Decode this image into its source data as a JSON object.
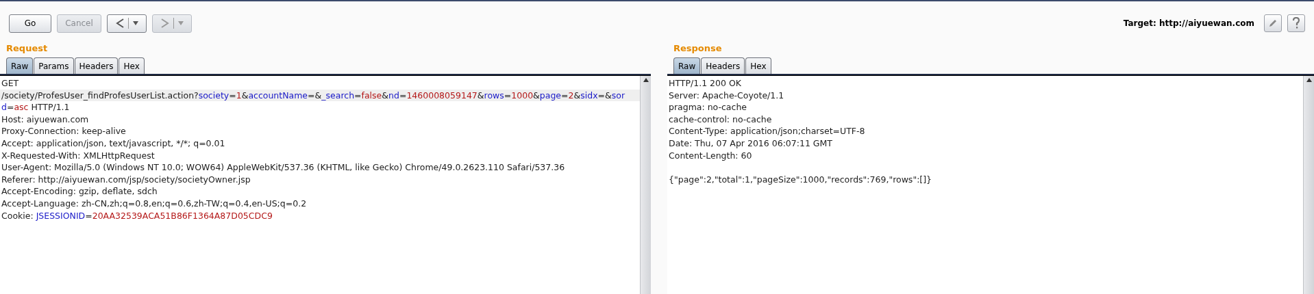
{
  "toolbar": {
    "buttons": [
      {
        "kind": "text",
        "label": "Go",
        "disabled": false
      },
      {
        "kind": "text",
        "label": "Cancel",
        "disabled": true
      },
      {
        "kind": "back",
        "disabled": false
      },
      {
        "kind": "forward",
        "disabled": true
      }
    ],
    "target": "Target: http://aiyuewan.com"
  },
  "request": {
    "title": "Request",
    "tabs": [
      {
        "label": "Raw",
        "selected": true
      },
      {
        "label": "Params",
        "selected": false
      },
      {
        "label": "Headers",
        "selected": false
      },
      {
        "label": "Hex",
        "selected": false
      }
    ],
    "lines": [
      {
        "current": false,
        "segments": [
          {
            "kind": "plain",
            "text": "GET"
          }
        ]
      },
      {
        "current": true,
        "segments": [
          {
            "kind": "plain",
            "text": "/society/ProfesUser_findProfesUserList.action?"
          },
          {
            "kind": "name",
            "text": "society"
          },
          {
            "kind": "plain",
            "text": "="
          },
          {
            "kind": "value",
            "text": "1"
          },
          {
            "kind": "plain",
            "text": "&"
          },
          {
            "kind": "name",
            "text": "accountName"
          },
          {
            "kind": "plain",
            "text": "=&"
          },
          {
            "kind": "name",
            "text": "_search"
          },
          {
            "kind": "plain",
            "text": "="
          },
          {
            "kind": "value",
            "text": "false"
          },
          {
            "kind": "plain",
            "text": "&"
          },
          {
            "kind": "name",
            "text": "nd"
          },
          {
            "kind": "plain",
            "text": "="
          },
          {
            "kind": "value",
            "text": "1460008059147"
          },
          {
            "kind": "plain",
            "text": "&"
          },
          {
            "kind": "name",
            "text": "rows"
          },
          {
            "kind": "plain",
            "text": "="
          },
          {
            "kind": "value",
            "text": "1000"
          },
          {
            "kind": "plain",
            "text": "&"
          },
          {
            "kind": "name",
            "text": "page"
          },
          {
            "kind": "plain",
            "text": "="
          },
          {
            "kind": "value",
            "text": "2"
          },
          {
            "kind": "plain",
            "text": "&"
          },
          {
            "kind": "name",
            "text": "sidx"
          },
          {
            "kind": "plain",
            "text": "=&"
          },
          {
            "kind": "name",
            "text": "sor"
          }
        ]
      },
      {
        "current": false,
        "segments": [
          {
            "kind": "name",
            "text": "d"
          },
          {
            "kind": "plain",
            "text": "="
          },
          {
            "kind": "value",
            "text": "asc"
          },
          {
            "kind": "plain",
            "text": " HTTP/1.1"
          }
        ]
      },
      {
        "current": false,
        "segments": [
          {
            "kind": "plain",
            "text": "Host: aiyuewan.com"
          }
        ]
      },
      {
        "current": false,
        "segments": [
          {
            "kind": "plain",
            "text": "Proxy-Connection: keep-alive"
          }
        ]
      },
      {
        "current": false,
        "segments": [
          {
            "kind": "plain",
            "text": "Accept: application/json, text/javascript, */*; q=0.01"
          }
        ]
      },
      {
        "current": false,
        "segments": [
          {
            "kind": "plain",
            "text": "X-Requested-With: XMLHttpRequest"
          }
        ]
      },
      {
        "current": false,
        "segments": [
          {
            "kind": "plain",
            "text": "User-Agent: Mozilla/5.0 (Windows NT 10.0; WOW64) AppleWebKit/537.36 (KHTML, like Gecko) Chrome/49.0.2623.110 Safari/537.36"
          }
        ]
      },
      {
        "current": false,
        "segments": [
          {
            "kind": "plain",
            "text": "Referer: http://aiyuewan.com/jsp/society/societyOwner.jsp"
          }
        ]
      },
      {
        "current": false,
        "segments": [
          {
            "kind": "plain",
            "text": "Accept-Encoding: gzip, deflate, sdch"
          }
        ]
      },
      {
        "current": false,
        "segments": [
          {
            "kind": "plain",
            "text": "Accept-Language: zh-CN,zh;q=0.8,en;q=0.6,zh-TW;q=0.4,en-US;q=0.2"
          }
        ]
      },
      {
        "current": false,
        "segments": [
          {
            "kind": "plain",
            "text": "Cookie: "
          },
          {
            "kind": "name",
            "text": "JSESSIONID"
          },
          {
            "kind": "plain",
            "text": "="
          },
          {
            "kind": "value",
            "text": "20AA32539ACA51B86F1364A87D05CDC9"
          }
        ]
      }
    ]
  },
  "response": {
    "title": "Response",
    "tabs": [
      {
        "label": "Raw",
        "selected": true
      },
      {
        "label": "Headers",
        "selected": false
      },
      {
        "label": "Hex",
        "selected": false
      }
    ],
    "lines": [
      {
        "current": false,
        "segments": [
          {
            "kind": "plain",
            "text": "HTTP/1.1 200 OK"
          }
        ]
      },
      {
        "current": false,
        "segments": [
          {
            "kind": "plain",
            "text": "Server: Apache-Coyote/1.1"
          }
        ]
      },
      {
        "current": false,
        "segments": [
          {
            "kind": "plain",
            "text": "pragma: no-cache"
          }
        ]
      },
      {
        "current": false,
        "segments": [
          {
            "kind": "plain",
            "text": "cache-control: no-cache"
          }
        ]
      },
      {
        "current": false,
        "segments": [
          {
            "kind": "plain",
            "text": "Content-Type: application/json;charset=UTF-8"
          }
        ]
      },
      {
        "current": false,
        "segments": [
          {
            "kind": "plain",
            "text": "Date: Thu, 07 Apr 2016 06:07:11 GMT"
          }
        ]
      },
      {
        "current": false,
        "segments": [
          {
            "kind": "plain",
            "text": "Content-Length: 60"
          }
        ]
      },
      {
        "current": false,
        "blank_before": true,
        "segments": [
          {
            "kind": "plain",
            "text": "{\"page\":2,\"total\":1,\"pageSize\":1000,\"records\":769,\"rows\":[]}"
          }
        ]
      }
    ]
  }
}
